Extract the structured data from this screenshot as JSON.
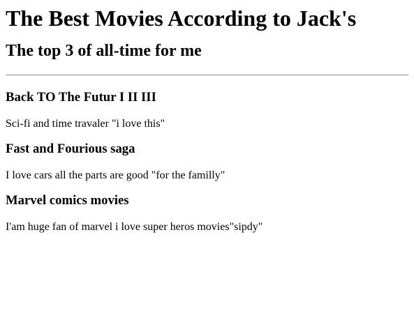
{
  "header": {
    "title": "The Best Movies According to Jack's",
    "subtitle": "The top 3 of all-time for me"
  },
  "movies": [
    {
      "title": "Back TO The Futur I II III",
      "description": "Sci-fi and time travaler \"i love this\""
    },
    {
      "title": "Fast and Fourious saga",
      "description": "I love cars all the parts are good \"for the familly\""
    },
    {
      "title": "Marvel comics movies",
      "description": "I'am huge fan of marvel i love super heros movies\"sipdy\""
    }
  ]
}
